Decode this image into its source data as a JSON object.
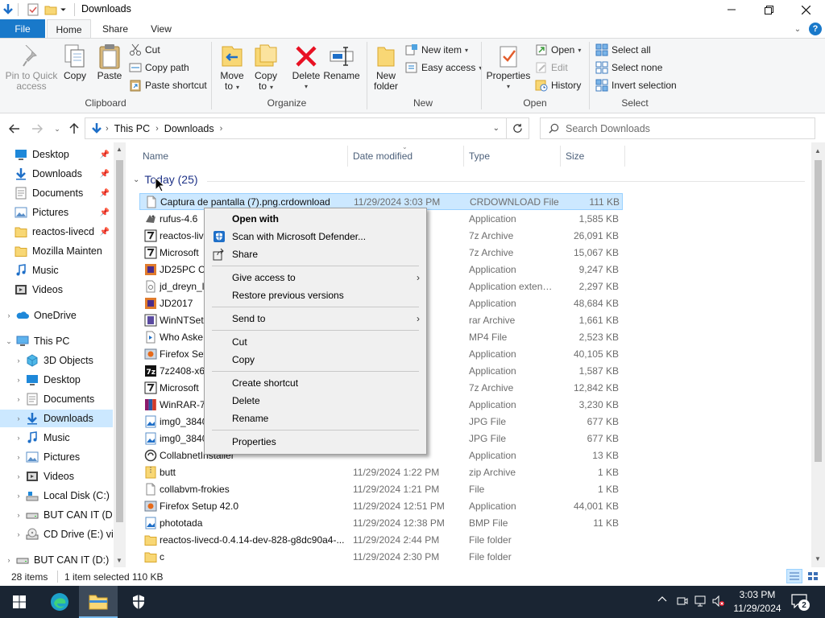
{
  "window": {
    "title": "Downloads"
  },
  "tabs": {
    "file": "File",
    "home": "Home",
    "share": "Share",
    "view": "View"
  },
  "ribbon": {
    "pin_line1": "Pin to Quick",
    "pin_line2": "access",
    "copy": "Copy",
    "paste": "Paste",
    "cut": "Cut",
    "copy_path": "Copy path",
    "paste_shortcut": "Paste shortcut",
    "clipboard_group": "Clipboard",
    "move_line1": "Move",
    "move_line2": "to",
    "copyto_line1": "Copy",
    "copyto_line2": "to",
    "delete": "Delete",
    "rename": "Rename",
    "organize_group": "Organize",
    "newfolder_line1": "New",
    "newfolder_line2": "folder",
    "new_item": "New item",
    "easy_access": "Easy access",
    "new_group": "New",
    "properties": "Properties",
    "open": "Open",
    "edit": "Edit",
    "history": "History",
    "open_group": "Open",
    "select_all": "Select all",
    "select_none": "Select none",
    "invert_selection": "Invert selection",
    "select_group": "Select"
  },
  "address": {
    "crumbs": [
      "This PC",
      "Downloads"
    ],
    "search_placeholder": "Search Downloads"
  },
  "nav": {
    "items": [
      {
        "label": "Desktop",
        "icon": "desktop-icon",
        "pinned": true
      },
      {
        "label": "Downloads",
        "icon": "downloads-icon",
        "pinned": true
      },
      {
        "label": "Documents",
        "icon": "documents-icon",
        "pinned": true
      },
      {
        "label": "Pictures",
        "icon": "pictures-icon",
        "pinned": true
      },
      {
        "label": "reactos-livecd",
        "icon": "folder-icon",
        "pinned": true
      },
      {
        "label": "Mozilla Mainten",
        "icon": "folder-icon",
        "pinned": false
      },
      {
        "label": "Music",
        "icon": "music-icon",
        "pinned": false
      },
      {
        "label": "Videos",
        "icon": "videos-icon",
        "pinned": false
      },
      {
        "label": "OneDrive",
        "icon": "onedrive-icon",
        "pinned": false
      },
      {
        "label": "This PC",
        "icon": "this-pc-icon",
        "pinned": false
      },
      {
        "label": "3D Objects",
        "icon": "3d-objects-icon",
        "pinned": false
      },
      {
        "label": "Desktop",
        "icon": "desktop-icon",
        "pinned": false
      },
      {
        "label": "Documents",
        "icon": "documents-icon",
        "pinned": false
      },
      {
        "label": "Downloads",
        "icon": "downloads-icon",
        "pinned": false
      },
      {
        "label": "Music",
        "icon": "music-icon",
        "pinned": false
      },
      {
        "label": "Pictures",
        "icon": "pictures-icon",
        "pinned": false
      },
      {
        "label": "Videos",
        "icon": "videos-icon",
        "pinned": false
      },
      {
        "label": "Local Disk (C:)",
        "icon": "local-disk-icon",
        "pinned": false
      },
      {
        "label": "BUT CAN IT (D:)",
        "icon": "drive-icon",
        "pinned": false
      },
      {
        "label": "CD Drive (E:) virt",
        "icon": "cd-drive-icon",
        "pinned": false
      },
      {
        "label": "BUT CAN IT (D:)",
        "icon": "drive-icon",
        "pinned": false
      }
    ]
  },
  "columns": {
    "name": "Name",
    "date": "Date modified",
    "type": "Type",
    "size": "Size"
  },
  "group": {
    "label": "Today (25)"
  },
  "files": [
    {
      "name": "Captura de pantalla (7).png.crdownload",
      "date": "11/29/2024 3:03 PM",
      "type": "CRDOWNLOAD File",
      "size": "111 KB",
      "icon": "blank-file-icon",
      "selected": true
    },
    {
      "name": "rufus-4.6",
      "date": "",
      "type": "Application",
      "size": "1,585 KB",
      "icon": "rufus-icon"
    },
    {
      "name": "reactos-liv",
      "date": "",
      "type": "7z Archive",
      "size": "26,091 KB",
      "icon": "7z-archive-icon"
    },
    {
      "name": "Microsoft",
      "date": "",
      "type": "7z Archive",
      "size": "15,067 KB",
      "icon": "7z-archive-icon"
    },
    {
      "name": "JD25PC Cr",
      "date": "",
      "type": "Application",
      "size": "9,247 KB",
      "icon": "app-icon"
    },
    {
      "name": "jd_dreyn_l",
      "date": "",
      "type": "Application exten…",
      "size": "2,297 KB",
      "icon": "dll-icon"
    },
    {
      "name": "JD2017",
      "date": "",
      "type": "Application",
      "size": "48,684 KB",
      "icon": "app-icon"
    },
    {
      "name": "WinNTSetu",
      "date": "",
      "type": "rar Archive",
      "size": "1,661 KB",
      "icon": "rar-archive-icon"
    },
    {
      "name": "Who Aske",
      "date": "",
      "type": "MP4 File",
      "size": "2,523 KB",
      "icon": "video-file-icon"
    },
    {
      "name": "Firefox Set",
      "date": "",
      "type": "Application",
      "size": "40,105 KB",
      "icon": "installer-icon"
    },
    {
      "name": "7z2408-x64",
      "date": "",
      "type": "Application",
      "size": "1,587 KB",
      "icon": "7zip-icon"
    },
    {
      "name": "Microsoft",
      "date": "",
      "type": "7z Archive",
      "size": "12,842 KB",
      "icon": "7z-archive-icon"
    },
    {
      "name": "WinRAR-7",
      "date": "",
      "type": "Application",
      "size": "3,230 KB",
      "icon": "winrar-icon"
    },
    {
      "name": "img0_3840",
      "date": "",
      "type": "JPG File",
      "size": "677 KB",
      "icon": "image-file-icon"
    },
    {
      "name": "img0_3840",
      "date": "",
      "type": "JPG File",
      "size": "677 KB",
      "icon": "image-file-icon"
    },
    {
      "name": "CollabnetInstaller",
      "date": "",
      "type": "Application",
      "size": "13 KB",
      "icon": "collabnet-icon"
    },
    {
      "name": "butt",
      "date": "11/29/2024 1:22 PM",
      "type": "zip Archive",
      "size": "1 KB",
      "icon": "zip-archive-icon"
    },
    {
      "name": "collabvm-frokies",
      "date": "11/29/2024 1:21 PM",
      "type": "File",
      "size": "1 KB",
      "icon": "blank-file-icon"
    },
    {
      "name": "Firefox Setup 42.0",
      "date": "11/29/2024 12:51 PM",
      "type": "Application",
      "size": "44,001 KB",
      "icon": "installer-icon"
    },
    {
      "name": "phototada",
      "date": "11/29/2024 12:38 PM",
      "type": "BMP File",
      "size": "11 KB",
      "icon": "image-file-icon"
    },
    {
      "name": "reactos-livecd-0.4.14-dev-828-g8dc90a4-...",
      "date": "11/29/2024 2:44 PM",
      "type": "File folder",
      "size": "",
      "icon": "folder-icon"
    },
    {
      "name": "c",
      "date": "11/29/2024 2:30 PM",
      "type": "File folder",
      "size": "",
      "icon": "folder-icon"
    }
  ],
  "status": {
    "items": "28 items",
    "selected": "1 item selected",
    "size": "110 KB"
  },
  "context_menu": {
    "open_with": "Open with",
    "scan": "Scan with Microsoft Defender...",
    "share": "Share",
    "give_access": "Give access to",
    "restore": "Restore previous versions",
    "send_to": "Send to",
    "cut": "Cut",
    "copy": "Copy",
    "create_shortcut": "Create shortcut",
    "delete": "Delete",
    "rename": "Rename",
    "properties": "Properties"
  },
  "taskbar": {
    "time": "3:03 PM",
    "date": "11/29/2024",
    "notification_count": "2"
  },
  "colors": {
    "accent": "#1979ca",
    "selection": "#cce8ff",
    "taskbar": "#1a2533",
    "delete_red": "#e81123"
  }
}
